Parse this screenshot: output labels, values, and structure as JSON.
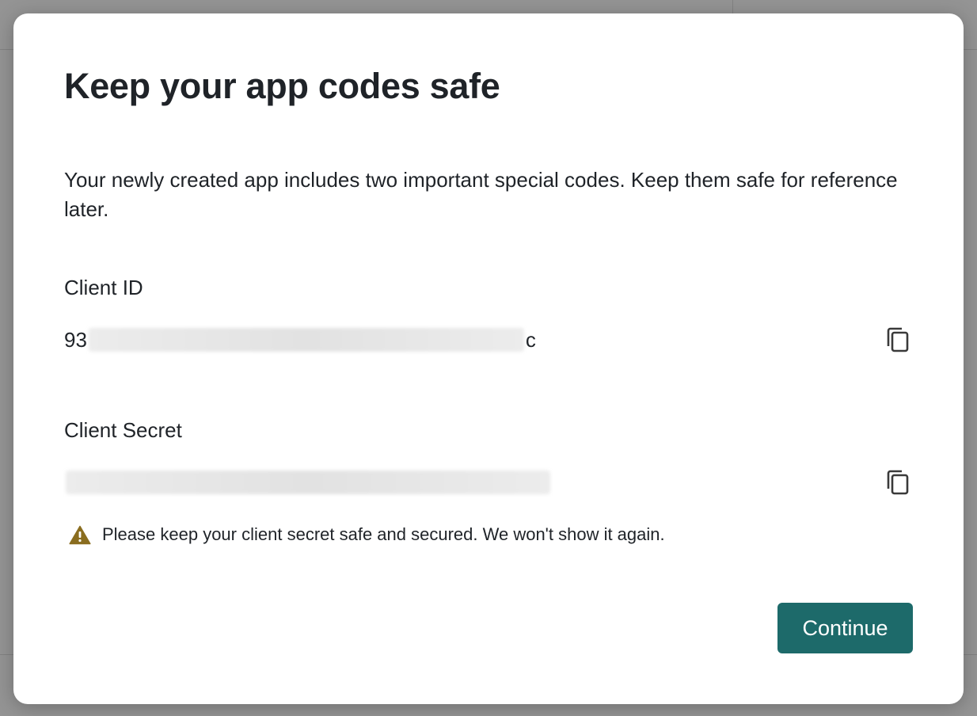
{
  "modal": {
    "title": "Keep your app codes safe",
    "description": "Your newly created app includes two important special codes. Keep them safe for reference later.",
    "client_id": {
      "label": "Client ID",
      "value_prefix": "93",
      "value_suffix": "c",
      "copy_icon": "copy-icon"
    },
    "client_secret": {
      "label": "Client Secret",
      "copy_icon": "copy-icon"
    },
    "warning": {
      "icon": "warning-triangle-icon",
      "text": "Please keep your client secret safe and secured. We won't show it again."
    },
    "continue_label": "Continue"
  },
  "colors": {
    "primary_button": "#1d6a6a",
    "warning_icon": "#8a6d1f"
  }
}
